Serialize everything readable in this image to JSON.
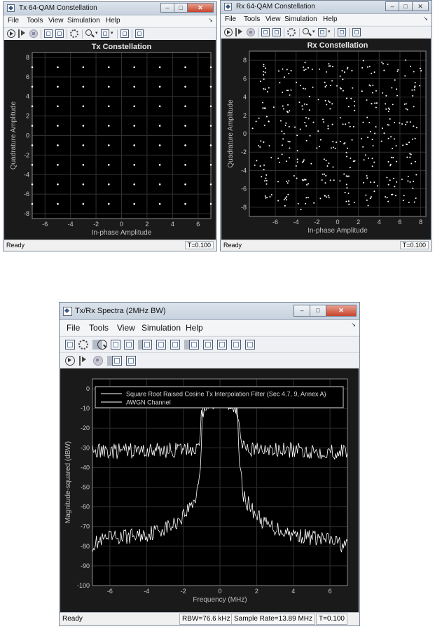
{
  "menu": [
    "File",
    "Tools",
    "View",
    "Simulation",
    "Help"
  ],
  "windows": {
    "tx": {
      "title": "Tx 64-QAM Constellation",
      "plot_title": "Tx Constellation",
      "status": "Ready",
      "time": "T=0.100"
    },
    "rx": {
      "title": "Rx 64-QAM Constellation",
      "plot_title": "Rx Constellation",
      "status": "Ready",
      "time": "T=0.100"
    },
    "spec": {
      "title": "Tx/Rx Spectra (2MHz BW)",
      "status": "Ready",
      "rbw": "RBW=76.6 kHz",
      "sample_rate": "Sample Rate=13.89 MHz",
      "time": "T=0.100"
    }
  },
  "icons": {
    "window": [
      "app-icon",
      "minimize-icon",
      "maximize-icon",
      "close-icon"
    ],
    "toolbar_common": [
      "run-icon",
      "step-forward-icon",
      "stop-icon",
      "highlight-signal-icon",
      "snapshot-icon",
      "settings-icon",
      "zoom-in-icon",
      "fit-to-view-icon",
      "autoscale-icon",
      "print-icon"
    ],
    "toolbar_spectrum_extra": [
      "print-icon",
      "settings-icon",
      "zoom-in-icon",
      "zoom-x-icon",
      "zoom-y-icon",
      "fit-x-icon",
      "fit-y-icon",
      "fit-to-view-icon",
      "data-cursor-icon",
      "peak-finder-icon",
      "channel-measure-icon",
      "distortion-icon",
      "ccdf-icon"
    ]
  },
  "chart_data": [
    {
      "type": "scatter",
      "title": "Tx Constellation",
      "xlabel": "In-phase Amplitude",
      "ylabel": "Quadrature Amplitude",
      "xlim": [
        -7,
        7
      ],
      "ylim": [
        -8.5,
        8.5
      ],
      "xticks": [
        -6,
        -4,
        -2,
        0,
        2,
        4,
        6
      ],
      "yticks": [
        -8,
        -6,
        -4,
        -2,
        0,
        2,
        4,
        6,
        8
      ],
      "grid": true,
      "points": "64-QAM ideal grid, I and Q in {-7,-5,-3,-1,1,3,5,7}",
      "levels": [
        -7,
        -5,
        -3,
        -1,
        1,
        3,
        5,
        7
      ],
      "point_color": "#ffffff",
      "background": "#000000"
    },
    {
      "type": "scatter",
      "title": "Rx Constellation",
      "xlabel": "In-phase Amplitude",
      "ylabel": "Quadrature Amplitude",
      "xlim": [
        -8.5,
        8.5
      ],
      "ylim": [
        -9,
        9
      ],
      "xticks": [
        -6,
        -4,
        -2,
        0,
        2,
        4,
        6,
        8
      ],
      "yticks": [
        -8,
        -6,
        -4,
        -2,
        0,
        2,
        4,
        6,
        8
      ],
      "grid": true,
      "levels": [
        -7,
        -5,
        -3,
        -1,
        1,
        3,
        5,
        7
      ],
      "point_spread": 0.45,
      "points_per_symbol": 6,
      "point_color": "#ffffff",
      "background": "#000000"
    },
    {
      "type": "line",
      "title": "",
      "xlabel": "Frequency (MHz)",
      "ylabel": "Magnitude-squared (dBW)",
      "xlim": [
        -6.95,
        6.95
      ],
      "ylim": [
        -100,
        5
      ],
      "xticks": [
        -6,
        -4,
        -2,
        0,
        2,
        4,
        6
      ],
      "yticks": [
        0,
        -10,
        -20,
        -30,
        -40,
        -50,
        -60,
        -70,
        -80,
        -90,
        -100
      ],
      "grid": true,
      "legend_placement": "top",
      "series": [
        {
          "name": "Square Root Raised Cosine Tx Interpolation Filter (Sec 4.7, 9, Annex A)",
          "profile": [
            [
              -6.95,
              -79
            ],
            [
              -6,
              -76
            ],
            [
              -4,
              -74
            ],
            [
              -2.5,
              -69
            ],
            [
              -1.8,
              -62
            ],
            [
              -1.3,
              -55
            ],
            [
              -1.05,
              -38
            ],
            [
              -0.95,
              -12
            ],
            [
              -0.7,
              -7
            ],
            [
              0,
              -6
            ],
            [
              0.7,
              -7
            ],
            [
              0.95,
              -12
            ],
            [
              1.05,
              -38
            ],
            [
              1.3,
              -55
            ],
            [
              1.8,
              -62
            ],
            [
              2.5,
              -69
            ],
            [
              4,
              -74
            ],
            [
              6,
              -77
            ],
            [
              6.95,
              -80
            ]
          ],
          "ripple": 4
        },
        {
          "name": "AWGN Channel",
          "profile": [
            [
              -6.95,
              -32
            ],
            [
              -2,
              -31
            ],
            [
              -1.15,
              -30
            ],
            [
              -1.0,
              -12
            ],
            [
              -0.8,
              -7
            ],
            [
              0,
              -6
            ],
            [
              0.8,
              -7
            ],
            [
              1.0,
              -12
            ],
            [
              1.15,
              -30
            ],
            [
              2,
              -31
            ],
            [
              6.95,
              -32
            ]
          ],
          "ripple": 4
        }
      ],
      "line_color": "#ffffff",
      "background": "#000000"
    }
  ]
}
